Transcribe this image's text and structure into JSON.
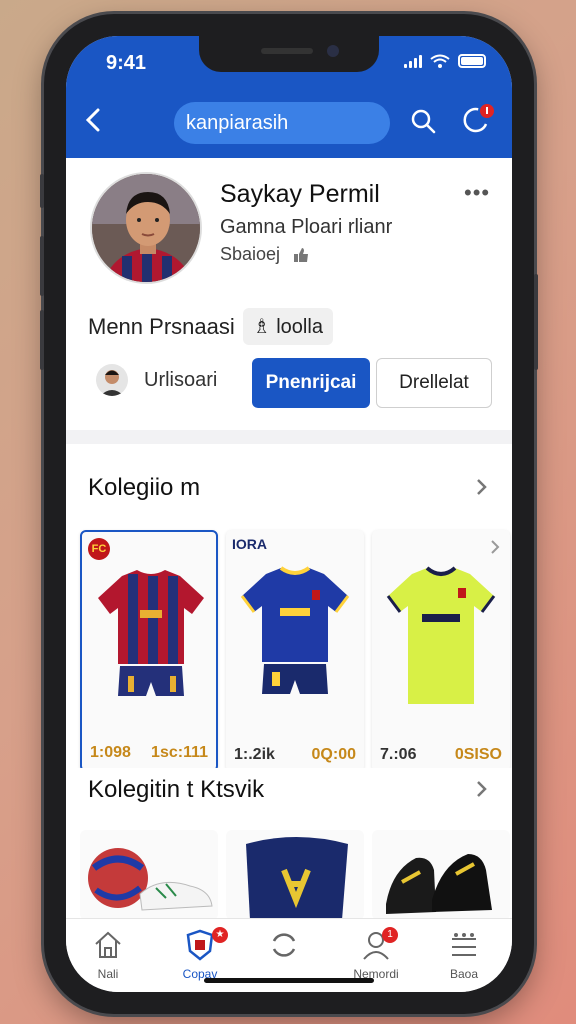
{
  "status_bar": {
    "time": "9:41"
  },
  "header": {
    "search_text": "kanpiarasih"
  },
  "profile": {
    "name": "Saykay Permil",
    "subtitle": "Gamna Ploari rlianr",
    "status": "Sbaioej",
    "member_label": "Menn Prsnaasi",
    "member_chip": "♗ loolla",
    "follower_label": "Urlisoari",
    "primary_button": "Pnenrijcai",
    "secondary_button": "Drellelat"
  },
  "collection": {
    "title": "Kolegiio m",
    "items": [
      {
        "tag": "",
        "price_left": "1:098",
        "price_right": "1sc:111",
        "colors": [
          "#b3172e",
          "#24307a"
        ]
      },
      {
        "tag": "IORA",
        "price_left": "1:.2ik",
        "price_right": "0Q:00",
        "colors": [
          "#1f3aa6",
          "#ffd23a"
        ]
      },
      {
        "tag": "",
        "price_left": "7.:06",
        "price_right": "0SISO",
        "colors": [
          "#d8f046",
          "#1a1f4a"
        ]
      }
    ]
  },
  "accessories": {
    "title": "Kolegitin t Ktsvik"
  },
  "tabbar": {
    "tabs": [
      {
        "label": "Nali",
        "icon": "home-icon"
      },
      {
        "label": "Copav",
        "icon": "shield-badge-icon",
        "active": true
      },
      {
        "label": "",
        "icon": "refresh-icon"
      },
      {
        "label": "Nemordi",
        "icon": "profile-icon"
      },
      {
        "label": "Baoa",
        "icon": "menu-icon"
      }
    ]
  }
}
